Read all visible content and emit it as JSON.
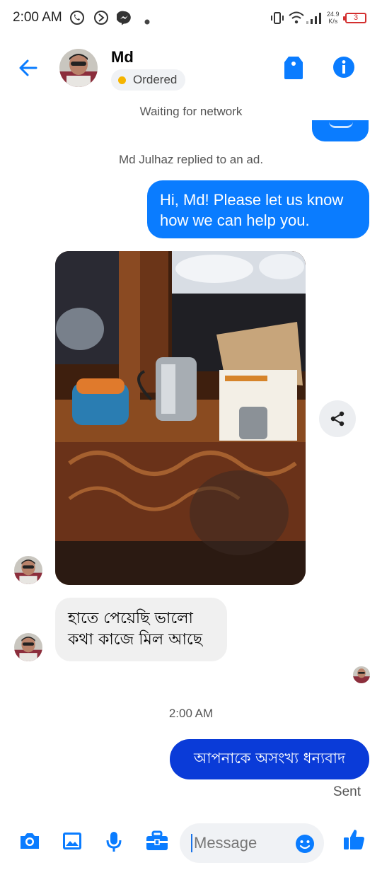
{
  "status_bar": {
    "time": "2:00 AM",
    "speed_value": "24.9",
    "speed_unit": "K/s",
    "battery": "3",
    "icons": [
      "whatsapp-icon",
      "sync-icon",
      "messenger-icon",
      "dot-icon",
      "vibrate-icon",
      "wifi-icon",
      "signal-icon",
      "battery-icon"
    ]
  },
  "header": {
    "contact_name": "Md",
    "status_label": "Ordered",
    "status_color": "#f5b400"
  },
  "network_status": "Waiting for network",
  "conversation": {
    "ad_note": "Md Julhaz replied to an ad.",
    "outgoing_greeting": "Hi, Md! Please let us know how we can help you.",
    "incoming_reply": "হাতে পেয়েছি ভালো কথা কাজে মিল আছে",
    "timestamp": "2:00 AM",
    "outgoing_thanks": "আপনাকে অসংখ্য ধন্যবাদ",
    "delivery_status": "Sent"
  },
  "composer": {
    "placeholder": "Message",
    "icons": [
      "camera-icon",
      "gallery-icon",
      "microphone-icon",
      "briefcase-icon",
      "emoji-icon",
      "like-icon"
    ]
  },
  "colors": {
    "accent": "#0a7cff",
    "dark_bubble": "#0a3bd8",
    "incoming_bubble": "#f0f0f0"
  }
}
